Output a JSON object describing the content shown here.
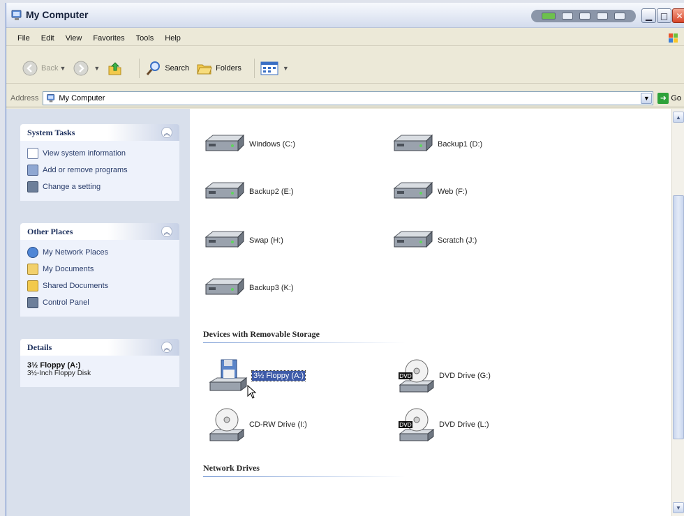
{
  "window": {
    "title": "My Computer"
  },
  "menu": [
    "File",
    "Edit",
    "View",
    "Favorites",
    "Tools",
    "Help"
  ],
  "toolbar": {
    "back_label": "Back",
    "search_label": "Search",
    "folders_label": "Folders"
  },
  "address": {
    "label": "Address",
    "value": "My Computer",
    "go_label": "Go"
  },
  "taskpane": {
    "system_tasks": {
      "title": "System Tasks",
      "items": [
        "View system information",
        "Add or remove programs",
        "Change a setting"
      ]
    },
    "other_places": {
      "title": "Other Places",
      "items": [
        "My Network Places",
        "My Documents",
        "Shared Documents",
        "Control Panel"
      ]
    },
    "details": {
      "title": "Details",
      "name": "3½ Floppy (A:)",
      "description": "3½-Inch Floppy Disk"
    }
  },
  "hard_drives": [
    "Windows (C:)",
    "Backup1 (D:)",
    "Backup2 (E:)",
    "Web (F:)",
    "Swap (H:)",
    "Scratch (J:)",
    "Backup3 (K:)"
  ],
  "removable": {
    "heading": "Devices with Removable Storage",
    "items": [
      "3½ Floppy (A:)",
      "DVD Drive (G:)",
      "CD-RW Drive (I:)",
      "DVD Drive (L:)"
    ],
    "dvd_badge": "DVD"
  },
  "network": {
    "heading": "Network Drives"
  },
  "colors": {
    "taskpane_bg": "#d9e0ec",
    "selection": "#3d5aa8",
    "link": "#2a3d6b"
  }
}
